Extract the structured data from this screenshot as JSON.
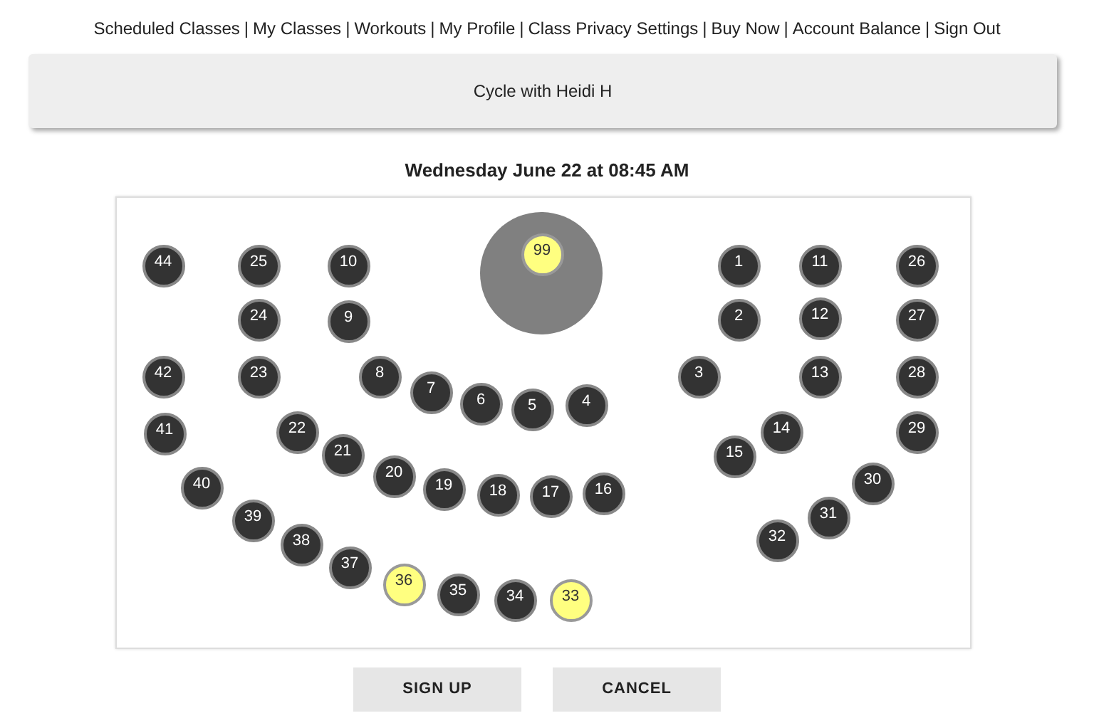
{
  "nav": {
    "separator": "|",
    "links": [
      {
        "label": "Scheduled Classes"
      },
      {
        "label": "My Classes"
      },
      {
        "label": "Workouts"
      },
      {
        "label": "My Profile"
      },
      {
        "label": "Class Privacy Settings"
      },
      {
        "label": "Buy Now"
      },
      {
        "label": "Account Balance"
      },
      {
        "label": "Sign Out"
      }
    ]
  },
  "class_title": "Cycle with Heidi H",
  "date": "Wednesday June 22 at 08:45 AM",
  "instructor_seat": {
    "number": "99",
    "available": true
  },
  "seats": [
    {
      "number": "44",
      "available": false
    },
    {
      "number": "25",
      "available": false
    },
    {
      "number": "10",
      "available": false
    },
    {
      "number": "1",
      "available": false
    },
    {
      "number": "11",
      "available": false
    },
    {
      "number": "26",
      "available": false
    },
    {
      "number": "24",
      "available": false
    },
    {
      "number": "9",
      "available": false
    },
    {
      "number": "2",
      "available": false
    },
    {
      "number": "12",
      "available": false
    },
    {
      "number": "27",
      "available": false
    },
    {
      "number": "42",
      "available": false
    },
    {
      "number": "23",
      "available": false
    },
    {
      "number": "8",
      "available": false
    },
    {
      "number": "7",
      "available": false
    },
    {
      "number": "6",
      "available": false
    },
    {
      "number": "5",
      "available": false
    },
    {
      "number": "4",
      "available": false
    },
    {
      "number": "3",
      "available": false
    },
    {
      "number": "13",
      "available": false
    },
    {
      "number": "28",
      "available": false
    },
    {
      "number": "41",
      "available": false
    },
    {
      "number": "22",
      "available": false
    },
    {
      "number": "21",
      "available": false
    },
    {
      "number": "14",
      "available": false
    },
    {
      "number": "15",
      "available": false
    },
    {
      "number": "29",
      "available": false
    },
    {
      "number": "40",
      "available": false
    },
    {
      "number": "20",
      "available": false
    },
    {
      "number": "19",
      "available": false
    },
    {
      "number": "18",
      "available": false
    },
    {
      "number": "17",
      "available": false
    },
    {
      "number": "16",
      "available": false
    },
    {
      "number": "30",
      "available": false
    },
    {
      "number": "39",
      "available": false
    },
    {
      "number": "31",
      "available": false
    },
    {
      "number": "38",
      "available": false
    },
    {
      "number": "32",
      "available": false
    },
    {
      "number": "37",
      "available": false
    },
    {
      "number": "36",
      "available": true
    },
    {
      "number": "35",
      "available": false
    },
    {
      "number": "34",
      "available": false
    },
    {
      "number": "33",
      "available": true
    }
  ],
  "buttons": [
    {
      "label": "SIGN UP"
    },
    {
      "label": "CANCEL"
    }
  ]
}
